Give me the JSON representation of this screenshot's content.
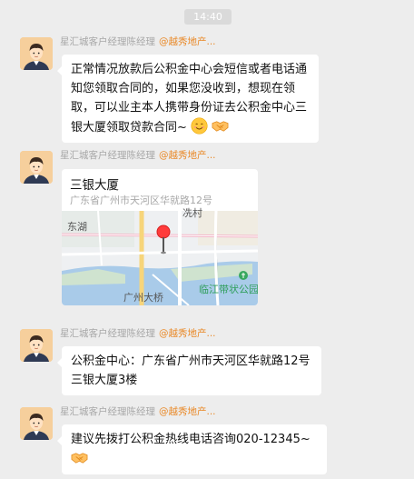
{
  "time": "14:40",
  "colors": {
    "background": "#ededed",
    "bubble": "#ffffff",
    "sender": "#a8a8a8",
    "org": "#e98a2a"
  },
  "messages": [
    {
      "sender": "星汇城客户经理陈经理",
      "org": "@越秀地产...",
      "text": "正常情况放款后公积金中心会短信或者电话通知您领取合同的，如果您没收到，想现在领取，可以业主本人携带身份证去公积金中心三银大厦领取贷款合同~",
      "emoji": [
        "smile-icon",
        "handshake-icon"
      ]
    },
    {
      "sender": "星汇城客户经理陈经理",
      "org": "@越秀地产...",
      "location": {
        "name": "三银大厦",
        "address": "广东省广州市天河区华就路12号",
        "map_labels": {
          "lake": "东湖",
          "village": "冼村",
          "bridge": "广州大桥",
          "park": "临江带状公园"
        }
      }
    },
    {
      "sender": "星汇城客户经理陈经理",
      "org": "@越秀地产...",
      "text": "公积金中心：广东省广州市天河区华就路12号三银大厦3楼"
    },
    {
      "sender": "星汇城客户经理陈经理",
      "org": "@越秀地产...",
      "text": "建议先拨打公积金热线电话咨询020-12345~",
      "emoji": [
        "handshake-icon"
      ]
    }
  ]
}
